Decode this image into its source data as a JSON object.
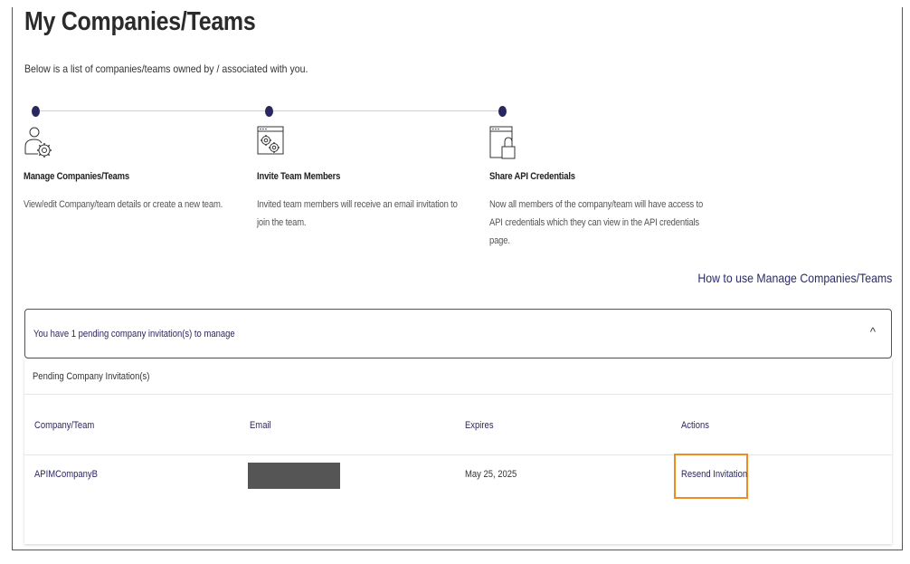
{
  "page": {
    "title": "My Companies/Teams",
    "subtitle": "Below is a list of companies/teams owned by / associated with you."
  },
  "steps": [
    {
      "icon": "user-gear-icon",
      "title": "Manage Companies/Teams",
      "description": "View/edit Company/team details or create a new team."
    },
    {
      "icon": "browser-gear-icon",
      "title": "Invite Team Members",
      "description": "Invited team members will receive an email invitation to join the team."
    },
    {
      "icon": "browser-lock-icon",
      "title": "Share API Credentials",
      "description": "Now all members of the company/team will have access to API credentials which they can view in the API credentials page."
    }
  ],
  "help_link": "How to use Manage Companies/Teams",
  "accordion": {
    "summary": "You have 1 pending company invitation(s) to manage",
    "chevron": "^"
  },
  "pending": {
    "header": "Pending Company Invitation(s)",
    "columns": [
      "Company/Team",
      "Email",
      "Expires",
      "Actions"
    ],
    "rows": [
      {
        "company": "APIMCompanyB",
        "email": "",
        "expires": "May 25, 2025",
        "action": "Resend Invitation"
      }
    ]
  },
  "colors": {
    "accent": "#2a2660",
    "highlight": "#f08a24",
    "accordion_border": "#3b5e52"
  }
}
